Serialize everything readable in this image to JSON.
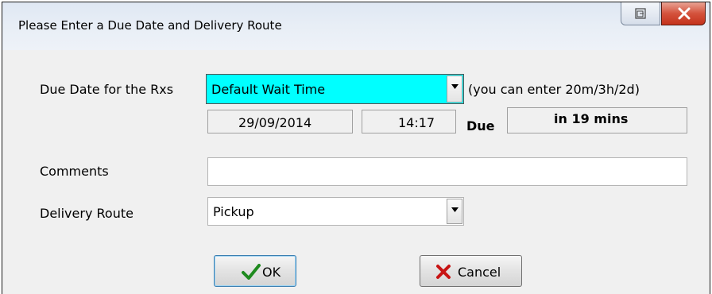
{
  "window": {
    "title": "Please Enter a Due Date and Delivery Route"
  },
  "due_date": {
    "label": "Due Date for the Rxs",
    "selected": "Default Wait Time",
    "hint": "(you can enter 20m/3h/2d)",
    "date": "29/09/2014",
    "time": "14:17",
    "due_label": "Due",
    "due_status": "in 19 mins",
    "highlight_color": "#00ffff"
  },
  "comments": {
    "label": "Comments",
    "value": ""
  },
  "delivery_route": {
    "label": "Delivery Route",
    "selected": "Pickup"
  },
  "buttons": {
    "ok_label": "OK",
    "cancel_label": "Cancel"
  }
}
